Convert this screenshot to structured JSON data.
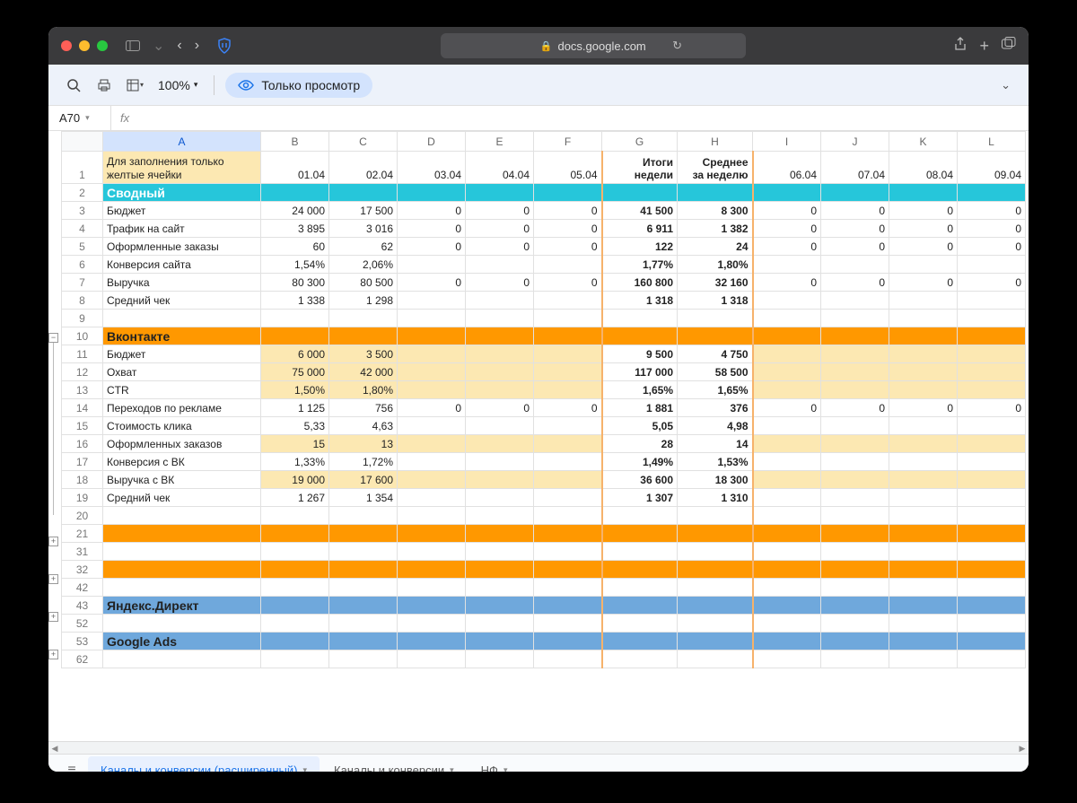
{
  "browser": {
    "url": "docs.google.com"
  },
  "toolbar": {
    "zoom": "100%",
    "view_only": "Только просмотр"
  },
  "namebox": {
    "cell": "A70",
    "fx": "fx"
  },
  "columns": [
    "A",
    "B",
    "C",
    "D",
    "E",
    "F",
    "G",
    "H",
    "I",
    "J",
    "K",
    "L"
  ],
  "header_row": {
    "A": "Для заполнения только желтые ячейки",
    "dates1": [
      "01.04",
      "02.04",
      "03.04",
      "04.04",
      "05.04"
    ],
    "G": "Итоги недели",
    "H": "Среднее за неделю",
    "dates2": [
      "06.04",
      "07.04",
      "08.04",
      "09.04"
    ]
  },
  "sections": {
    "svodny": "Сводный",
    "vk": "Вконтакте",
    "yandex": "Яндекс.Директ",
    "google": "Google Ads"
  },
  "rows": {
    "r3": {
      "lbl": "Бюджет",
      "v": [
        "24 000",
        "17 500",
        "0",
        "0",
        "0",
        "41 500",
        "8 300",
        "0",
        "0",
        "0",
        "0"
      ]
    },
    "r4": {
      "lbl": "Трафик на сайт",
      "v": [
        "3 895",
        "3 016",
        "0",
        "0",
        "0",
        "6 911",
        "1 382",
        "0",
        "0",
        "0",
        "0"
      ]
    },
    "r5": {
      "lbl": "Оформленные заказы",
      "v": [
        "60",
        "62",
        "0",
        "0",
        "0",
        "122",
        "24",
        "0",
        "0",
        "0",
        "0"
      ]
    },
    "r6": {
      "lbl": "Конверсия сайта",
      "v": [
        "1,54%",
        "2,06%",
        "",
        "",
        "",
        "1,77%",
        "1,80%",
        "",
        "",
        "",
        ""
      ]
    },
    "r7": {
      "lbl": "Выручка",
      "v": [
        "80 300",
        "80 500",
        "0",
        "0",
        "0",
        "160 800",
        "32 160",
        "0",
        "0",
        "0",
        "0"
      ]
    },
    "r8": {
      "lbl": "Средний чек",
      "v": [
        "1 338",
        "1 298",
        "",
        "",
        "",
        "1 318",
        "1 318",
        "",
        "",
        "",
        ""
      ]
    },
    "r11": {
      "lbl": "Бюджет",
      "v": [
        "6 000",
        "3 500",
        "",
        "",
        "",
        "9 500",
        "4 750",
        "",
        "",
        "",
        ""
      ]
    },
    "r12": {
      "lbl": "Охват",
      "v": [
        "75 000",
        "42 000",
        "",
        "",
        "",
        "117 000",
        "58 500",
        "",
        "",
        "",
        ""
      ]
    },
    "r13": {
      "lbl": "CTR",
      "v": [
        "1,50%",
        "1,80%",
        "",
        "",
        "",
        "1,65%",
        "1,65%",
        "",
        "",
        "",
        ""
      ]
    },
    "r14": {
      "lbl": "Переходов по рекламе",
      "v": [
        "1 125",
        "756",
        "0",
        "0",
        "0",
        "1 881",
        "376",
        "0",
        "0",
        "0",
        "0"
      ]
    },
    "r15": {
      "lbl": "Стоимость клика",
      "v": [
        "5,33",
        "4,63",
        "",
        "",
        "",
        "5,05",
        "4,98",
        "",
        "",
        "",
        ""
      ]
    },
    "r16": {
      "lbl": "Оформленных заказов",
      "v": [
        "15",
        "13",
        "",
        "",
        "",
        "28",
        "14",
        "",
        "",
        "",
        ""
      ]
    },
    "r17": {
      "lbl": "Конверсия с ВК",
      "v": [
        "1,33%",
        "1,72%",
        "",
        "",
        "",
        "1,49%",
        "1,53%",
        "",
        "",
        "",
        ""
      ]
    },
    "r18": {
      "lbl": "Выручка с ВК",
      "v": [
        "19 000",
        "17 600",
        "",
        "",
        "",
        "36 600",
        "18 300",
        "",
        "",
        "",
        ""
      ]
    },
    "r19": {
      "lbl": "Средний чек",
      "v": [
        "1 267",
        "1 354",
        "",
        "",
        "",
        "1 307",
        "1 310",
        "",
        "",
        "",
        ""
      ]
    }
  },
  "row_nums": [
    "1",
    "2",
    "3",
    "4",
    "5",
    "6",
    "7",
    "8",
    "9",
    "10",
    "11",
    "12",
    "13",
    "14",
    "15",
    "16",
    "17",
    "18",
    "19",
    "20",
    "21",
    "31",
    "32",
    "42",
    "43",
    "52",
    "53",
    "62"
  ],
  "tabs": {
    "t1": "Каналы и конверсии (расширенный)",
    "t2": "Каналы и конверсии",
    "t3": "НФ"
  }
}
